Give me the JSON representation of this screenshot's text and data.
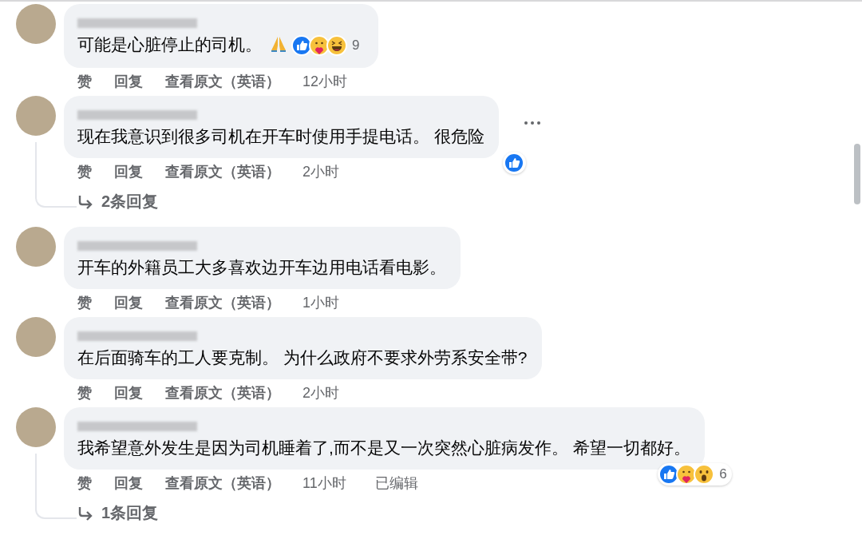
{
  "comments": [
    {
      "name_redacted": true,
      "text": "可能是心脏停止的司机。",
      "trailing_emoji": {
        "kind": "pray"
      },
      "reactions": {
        "icons": [
          {
            "kind": "like"
          },
          {
            "kind": "care"
          },
          {
            "kind": "haha"
          }
        ],
        "count": "9"
      },
      "actions": [
        "赞",
        "回复",
        "查看原文（英语）"
      ],
      "time": "12小时"
    },
    {
      "name_redacted": true,
      "text": "现在我意识到很多司机在开车时使用手提电话。 很危险",
      "reactions": {
        "icons": [
          {
            "kind": "like"
          }
        ]
      },
      "actions": [
        "赞",
        "回复",
        "查看原文（英语）"
      ],
      "time": "2小时",
      "more_visible": true,
      "replies": "2条回复"
    },
    {
      "name_redacted": true,
      "text": "开车的外籍员工大多喜欢边开车边用电话看电影。",
      "actions": [
        "赞",
        "回复",
        "查看原文（英语）"
      ],
      "time": "1小时"
    },
    {
      "name_redacted": true,
      "text": "在后面骑车的工人要克制。 为什么政府不要求外劳系安全带?",
      "actions": [
        "赞",
        "回复",
        "查看原文（英语）"
      ],
      "time": "2小时"
    },
    {
      "name_redacted": true,
      "text": "我希望意外发生是因为司机睡着了,而不是又一次突然心脏病发作。 希望一切都好。",
      "reactions": {
        "icons": [
          {
            "kind": "like"
          },
          {
            "kind": "care"
          },
          {
            "kind": "wow"
          }
        ],
        "count": "6"
      },
      "actions": [
        "赞",
        "回复",
        "查看原文（英语）"
      ],
      "time": "11小时",
      "edited": "已编辑",
      "replies": "1条回复"
    }
  ]
}
